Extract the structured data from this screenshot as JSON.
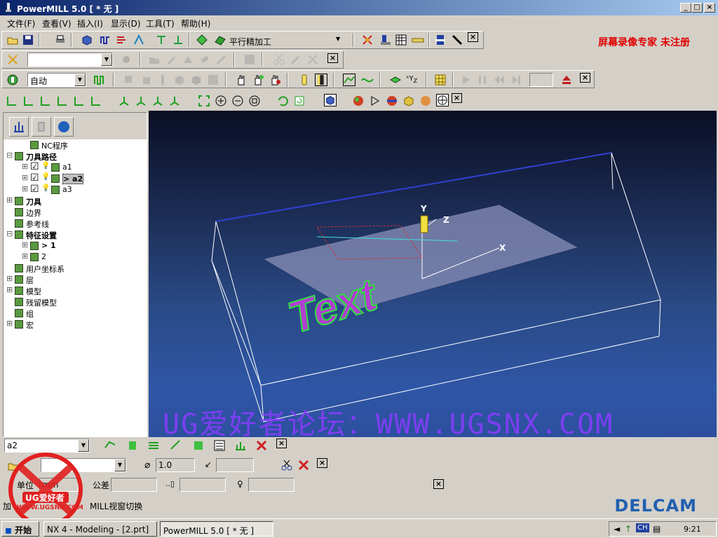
{
  "window": {
    "title": "PowerMILL 5.0   [ * 无 ]",
    "minimize": "_",
    "maximize": "□",
    "close": "×"
  },
  "menu": [
    "文件(F)",
    "查看(V)",
    "插入(I)",
    "显示(D)",
    "工具(T)",
    "帮助(H)"
  ],
  "watermark_top": "屏幕录像专家  未注册",
  "toolbar1": {
    "strategy_label": "平行精加工"
  },
  "toolbar3": {
    "mode_select": "自动"
  },
  "explorer": {
    "tree": [
      {
        "label": "NC程序",
        "bold": false,
        "level": 1,
        "expander": ""
      },
      {
        "label": "刀具路径",
        "bold": true,
        "level": 0,
        "expander": "−"
      },
      {
        "label": "a1",
        "bold": false,
        "level": 1,
        "expander": "+",
        "checked": true
      },
      {
        "label": "> a2",
        "bold": true,
        "level": 1,
        "expander": "+",
        "checked": true,
        "selected": true
      },
      {
        "label": "a3",
        "bold": false,
        "level": 1,
        "expander": "+",
        "checked": true
      },
      {
        "label": "刀具",
        "bold": true,
        "level": 0,
        "expander": "+"
      },
      {
        "label": "边界",
        "bold": false,
        "level": 0,
        "expander": ""
      },
      {
        "label": "参考线",
        "bold": false,
        "level": 0,
        "expander": ""
      },
      {
        "label": "特征设置",
        "bold": true,
        "level": 0,
        "expander": "−"
      },
      {
        "label": "> 1",
        "bold": true,
        "level": 1,
        "expander": "+"
      },
      {
        "label": "2",
        "bold": false,
        "level": 1,
        "expander": "+"
      },
      {
        "label": "用户坐标系",
        "bold": false,
        "level": 0,
        "expander": ""
      },
      {
        "label": "层",
        "bold": false,
        "level": 0,
        "expander": "+"
      },
      {
        "label": "模型",
        "bold": false,
        "level": 0,
        "expander": "+"
      },
      {
        "label": "残留模型",
        "bold": false,
        "level": 0,
        "expander": ""
      },
      {
        "label": "组",
        "bold": false,
        "level": 0,
        "expander": ""
      },
      {
        "label": "宏",
        "bold": false,
        "level": 0,
        "expander": "+"
      }
    ]
  },
  "viewport": {
    "axes": {
      "x": "X",
      "y": "Y",
      "z": "Z"
    },
    "model_text": "Text",
    "watermark": "UG爱好者论坛：WWW.UGSNX.COM"
  },
  "bottom": {
    "toolpath_select": "a2",
    "diameter_value": "1.0",
    "unit_label": "单位",
    "unit_value": "mm",
    "tolerance_label": "公差"
  },
  "status_text": "加工...切换...MILL视窗切换",
  "status_visible_left": "加",
  "status_visible_right": "MILL视窗切换",
  "delcam_logo": "DELCAM",
  "ug_logo": {
    "line1": "UG爱好者",
    "line2": "WWW.UGSNX.COM"
  },
  "taskbar": {
    "start": "开始",
    "tasks": [
      "NX 4 - Modeling - [2.prt]",
      "PowerMILL 5.0   [ * 无 ]"
    ],
    "tray_ime": "CH",
    "clock": "9:21"
  }
}
